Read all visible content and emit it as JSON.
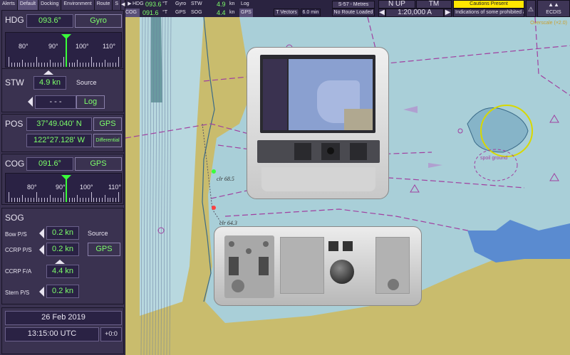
{
  "tabs": [
    "Alerts",
    "Default",
    "Docking",
    "Environment",
    "Route",
    "S"
  ],
  "hdg": {
    "label": "HDG",
    "value": "093.6°",
    "source": "Gyro",
    "scale": [
      "80°",
      "90°",
      "100°",
      "110°"
    ]
  },
  "stw": {
    "label": "STW",
    "value": "4.9 kn",
    "source_label": "Source",
    "secondary": "- - -",
    "source": "Log"
  },
  "pos": {
    "label": "POS",
    "lat": "37°49.040' N",
    "lon": "122°27.128' W",
    "lat_src": "GPS",
    "lon_src": "Differential"
  },
  "cog": {
    "label": "COG",
    "value": "091.6°",
    "source": "GPS",
    "scale": [
      "80°",
      "90°",
      "100°",
      "110°"
    ]
  },
  "sog": {
    "label": "SOG",
    "bow_label": "Bow P/S",
    "bow": "0.2 kn",
    "source_label": "Source",
    "ccrp_ps_label": "CCRP P/S",
    "ccrp_ps": "0.2 kn",
    "source": "GPS",
    "ccrp_fa_label": "CCRP F/A",
    "ccrp_fa": "4.4 kn",
    "stern_label": "Stern P/S",
    "stern": "0.2 kn"
  },
  "date": "26 Feb 2019",
  "time": "13:15:00 UTC",
  "tz": "+0:0",
  "topbar": {
    "hdg_label": "HDG",
    "hdg_val": "093.6",
    "hdg_unit": "°T",
    "hdg_src": "Gyro",
    "stw_label": "STW",
    "stw_val": "4.9",
    "stw_unit": "kn",
    "stw_src": "Log",
    "cog_label": "COG",
    "cog_val": "091.6",
    "cog_unit": "°T",
    "cog_src": "GPS",
    "sog_label": "SOG",
    "sog_val": "4.4",
    "sog_unit": "kn",
    "sog_src": "GPS",
    "vectors": "T Vectors",
    "vectors_val": "6.0 min",
    "chart_std": "S-57 - Metres",
    "route": "No Route Loaded",
    "orient": "N UP",
    "mode": "TM",
    "scale": "1:20,000 A",
    "cautions": "Cautions Present",
    "caution_msg": "Indications of some prohibited ar",
    "ecdis": "ECDIS"
  },
  "chart_labels": {
    "overscale": "Overscale (×2.0)",
    "clr1": "clr 68.5",
    "clr2": "clr 64.3",
    "spoil": "spoil ground"
  },
  "colors": {
    "panel": "#3a3250",
    "field_text": "#7dff6a",
    "caution": "#ffe600",
    "water": "#a9cfd8",
    "land": "#c8bb6a"
  }
}
